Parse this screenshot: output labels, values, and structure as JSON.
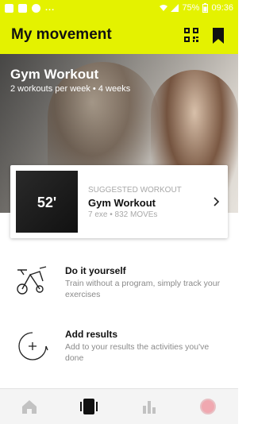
{
  "status_bar": {
    "battery": "75%",
    "time": "09:36",
    "more": "..."
  },
  "app_bar": {
    "title": "My movement"
  },
  "hero": {
    "title": "Gym Workout",
    "subtitle": "2 workouts per week • 4 weeks"
  },
  "suggested": {
    "duration": "52'",
    "label": "SUGGESTED WORKOUT",
    "name": "Gym Workout",
    "meta": "7 exe • 832 MOVEs"
  },
  "options": [
    {
      "title": "Do it yourself",
      "description": "Train without a program, simply track your exercises"
    },
    {
      "title": "Add results",
      "description": "Add to your results the activities you've done"
    }
  ],
  "nav": {
    "items": [
      "home-icon",
      "workout-icon",
      "stats-icon",
      "profile-icon"
    ]
  },
  "colors": {
    "accent": "#e4f200"
  }
}
